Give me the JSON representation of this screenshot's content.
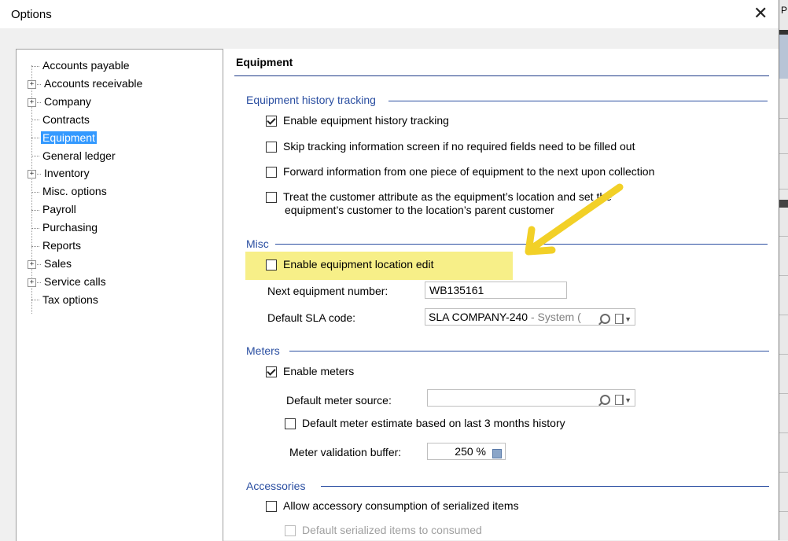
{
  "window": {
    "title": "Options"
  },
  "right_strip": {
    "text": "P"
  },
  "tree": {
    "items": [
      {
        "label": "Accounts payable",
        "expandable": false
      },
      {
        "label": "Accounts receivable",
        "expandable": true
      },
      {
        "label": "Company",
        "expandable": true
      },
      {
        "label": "Contracts",
        "expandable": false
      },
      {
        "label": "Equipment",
        "expandable": false,
        "selected": true
      },
      {
        "label": "General ledger",
        "expandable": false
      },
      {
        "label": "Inventory",
        "expandable": true
      },
      {
        "label": "Misc. options",
        "expandable": false
      },
      {
        "label": "Payroll",
        "expandable": false
      },
      {
        "label": "Purchasing",
        "expandable": false
      },
      {
        "label": "Reports",
        "expandable": false
      },
      {
        "label": "Sales",
        "expandable": true
      },
      {
        "label": "Service calls",
        "expandable": true
      },
      {
        "label": "Tax options",
        "expandable": false
      }
    ]
  },
  "panel": {
    "title": "Equipment",
    "history": {
      "title": "Equipment history tracking",
      "enable": {
        "label": "Enable equipment history tracking",
        "checked": true
      },
      "skip": {
        "label": "Skip tracking information screen if no required fields need to be filled out",
        "checked": false
      },
      "forward": {
        "label": "Forward information from one piece of equipment to the next upon collection",
        "checked": false
      },
      "treat_line1": "Treat the customer attribute as the equipment’s location and set the",
      "treat_line2": "equipment’s customer to the location’s parent customer"
    },
    "misc": {
      "title": "Misc",
      "location_edit": {
        "label": "Enable equipment location edit",
        "checked": false
      },
      "next_number_label": "Next equipment number:",
      "next_number_value": "WB135161",
      "sla_label": "Default SLA code:",
      "sla_value": "SLA COMPANY-240",
      "sla_suffix": " - System",
      "sla_cut": "("
    },
    "meters": {
      "title": "Meters",
      "enable": {
        "label": "Enable meters",
        "checked": true
      },
      "source_label": "Default meter source:",
      "source_value": "",
      "estimate": {
        "label": "Default meter estimate based on last 3 months history",
        "checked": false
      },
      "buffer_label": "Meter validation buffer:",
      "buffer_value": "250 %"
    },
    "accessories": {
      "title": "Accessories",
      "allow": {
        "label": "Allow accessory consumption of serialized items",
        "checked": false
      },
      "default_consumed": {
        "label": "Default serialized items to consumed",
        "checked": false
      }
    }
  },
  "colors": {
    "selection": "#3399ff",
    "section": "#2a4ea1",
    "highlight": "#f5ec6e",
    "arrow": "#f2d027"
  },
  "icons": {
    "close": "close-icon",
    "search": "magnifier-icon",
    "flag": "flag-dropdown-icon",
    "calculator": "calculator-icon",
    "arrow": "arrow-annotation"
  }
}
